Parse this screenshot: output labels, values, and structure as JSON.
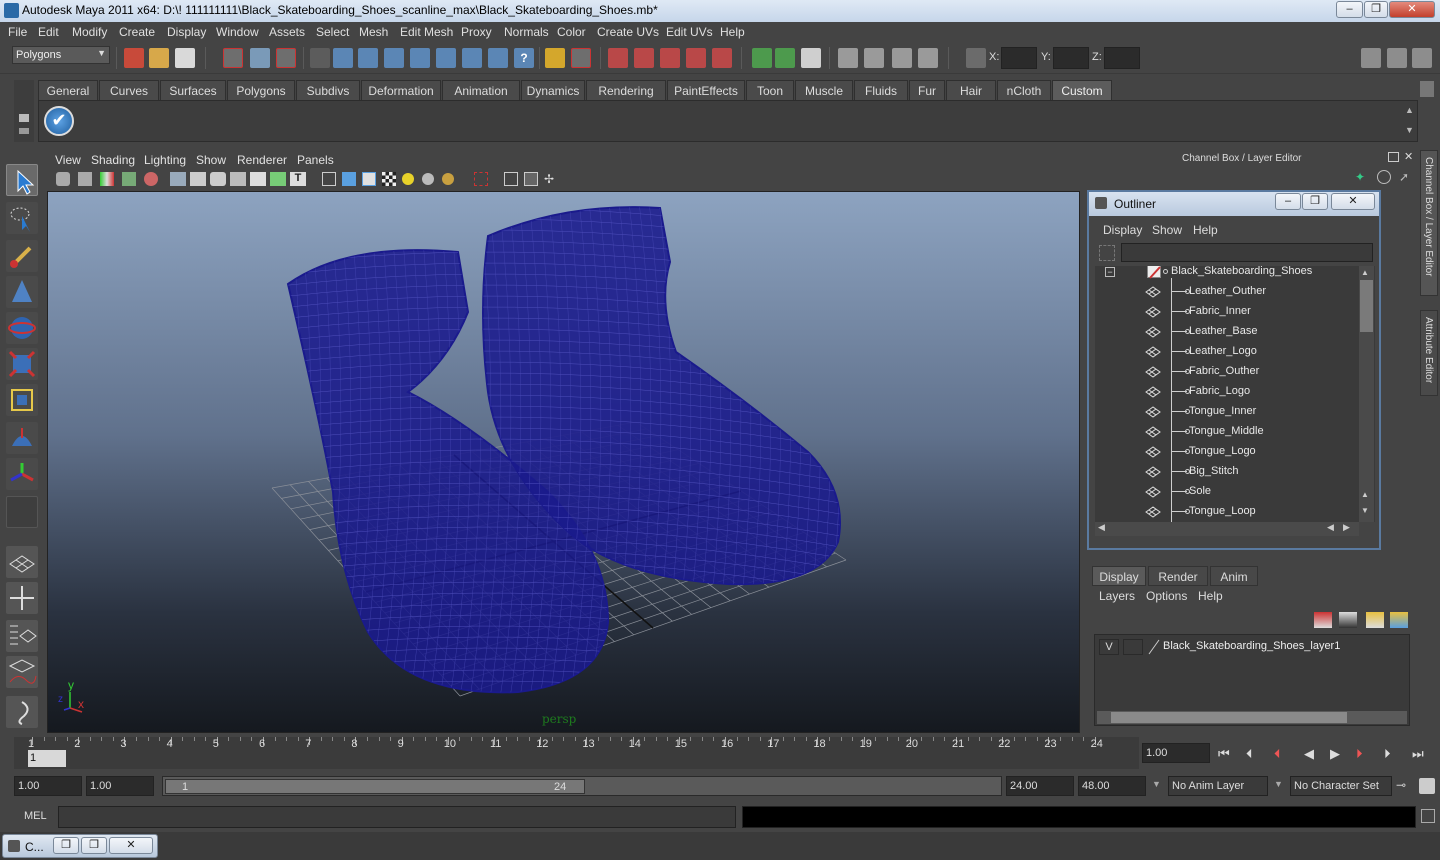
{
  "window": {
    "title": "Autodesk Maya 2011 x64: D:\\! 111111111\\Black_Skateboarding_Shoes_scanline_max\\Black_Skateboarding_Shoes.mb*",
    "controls": [
      "–",
      "❐",
      "✕"
    ]
  },
  "menubar": [
    "File",
    "Edit",
    "Modify",
    "Create",
    "Display",
    "Window",
    "Assets",
    "Select",
    "Mesh",
    "Edit Mesh",
    "Proxy",
    "Normals",
    "Color",
    "Create UVs",
    "Edit UVs",
    "Help"
  ],
  "statusline": {
    "mode": "Polygons",
    "x_label": "X:",
    "y_label": "Y:",
    "z_label": "Z:"
  },
  "shelf": {
    "tabs": [
      "General",
      "Curves",
      "Surfaces",
      "Polygons",
      "Subdivs",
      "Deformation",
      "Animation",
      "Dynamics",
      "Rendering",
      "PaintEffects",
      "Toon",
      "Muscle",
      "Fluids",
      "Fur",
      "Hair",
      "nCloth",
      "Custom"
    ],
    "active_tab": "Custom"
  },
  "viewport": {
    "menu": [
      "View",
      "Shading",
      "Lighting",
      "Show",
      "Renderer",
      "Panels"
    ],
    "camera_label": "persp",
    "axis_y": "y",
    "axis_x": "x",
    "axis_z": "z",
    "wire_color": "#1a1a8c"
  },
  "right_panel": {
    "header": "Channel Box / Layer Editor",
    "side_tabs": [
      "Channel Box / Layer Editor",
      "Attribute Editor"
    ]
  },
  "outliner": {
    "title": "Outliner",
    "menu": [
      "Display",
      "Show",
      "Help"
    ],
    "root": "Black_Skateboarding_Shoes",
    "children": [
      "Leather_Outher",
      "Fabric_Inner",
      "Leather_Base",
      "Leather_Logo",
      "Fabric_Outher",
      "Fabric_Logo",
      "Tongue_Inner",
      "Tongue_Middle",
      "Tongue_Logo",
      "Big_Stitch",
      "Sole",
      "Tongue_Loop"
    ]
  },
  "layer_editor": {
    "tabs": [
      "Display",
      "Render",
      "Anim"
    ],
    "active_tab": "Display",
    "menu": [
      "Layers",
      "Options",
      "Help"
    ],
    "layer_visible": "V",
    "layer_name": "Black_Skateboarding_Shoes_layer1"
  },
  "timeline": {
    "ticks": [
      "1",
      "2",
      "3",
      "4",
      "5",
      "6",
      "7",
      "8",
      "9",
      "10",
      "11",
      "12",
      "13",
      "14",
      "15",
      "16",
      "17",
      "18",
      "19",
      "20",
      "21",
      "22",
      "23",
      "24"
    ],
    "current_frame_marker": "1",
    "current_time": "1.00"
  },
  "range": {
    "start_time": "1.00",
    "playback_start": "1.00",
    "slider_start": "1",
    "slider_end": "24",
    "playback_end": "24.00",
    "end_time": "48.00",
    "anim_layer": "No Anim Layer",
    "character_set": "No Character Set"
  },
  "command_line": {
    "label": "MEL"
  },
  "taskbar": {
    "item_label": "C..."
  }
}
